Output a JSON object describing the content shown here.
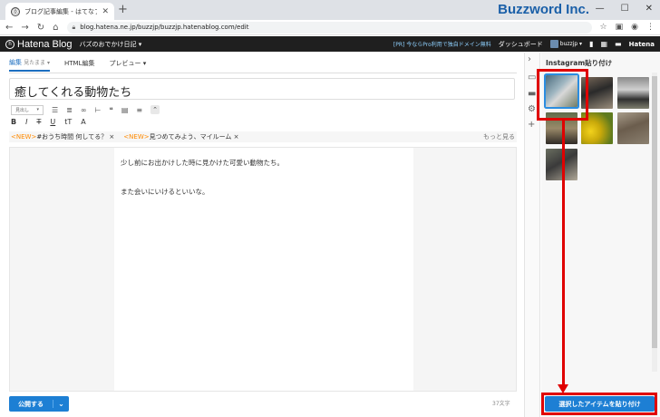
{
  "browser": {
    "tab_title": "ブログ記事編集 - はてなブログ",
    "new_tab": "+",
    "url": "blog.hatena.ne.jp/buzzjp/buzzjp.hatenablog.com/edit",
    "watermark": "Buzzword Inc."
  },
  "hatena_bar": {
    "logo": "Hatena Blog",
    "blog_name": "バズのおでかけ日記 ▾",
    "promo": "[PR] 今ならPro利用で独自ドメイン無料",
    "dashboard": "ダッシュボード",
    "user": "buzzjp ▾",
    "hatena": "Hatena"
  },
  "editor": {
    "tabs": [
      {
        "label": "編集",
        "sub": "見たまま ▾"
      },
      {
        "label": "HTML編集",
        "sub": ""
      },
      {
        "label": "プレビュー ▾",
        "sub": ""
      }
    ],
    "title": "癒してくれる動物たち",
    "heading_select": "見出し",
    "suggestions": [
      {
        "badge": "<NEW>",
        "text": "#おうち時間 何してる？ ×"
      },
      {
        "badge": "<NEW>",
        "text": "見つめてみよう、マイルーム ×"
      }
    ],
    "more": "もっと見る",
    "body": [
      "少し前にお出かけした時に見かけた可愛い動物たち。",
      "また会いにいけるといいな。"
    ],
    "publish": "公開する",
    "char_count": "37文字"
  },
  "panel": {
    "title": "Instagram貼り付け",
    "paste_button": "選択したアイテムを貼り付け"
  },
  "colors": {
    "accent": "#1d7fd4",
    "annotation": "#e00000",
    "new_badge": "#ff8a00"
  }
}
